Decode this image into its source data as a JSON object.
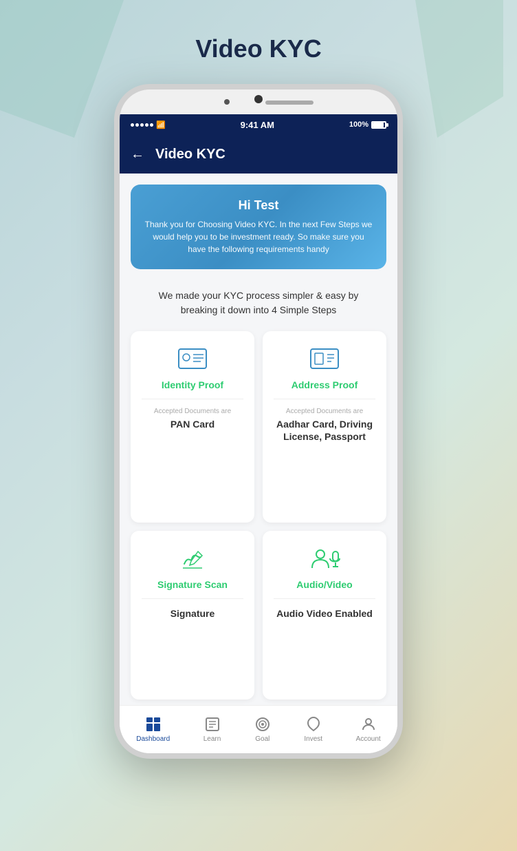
{
  "page": {
    "title": "Video KYC"
  },
  "header": {
    "title": "Video KYC",
    "back_label": "←"
  },
  "status_bar": {
    "time": "9:41 AM",
    "battery": "100%"
  },
  "banner": {
    "greeting": "Hi Test",
    "description": "Thank you for Choosing Video KYC. In the next Few Steps we would help you to be investment ready. So make sure you have the following requirements handy"
  },
  "steps_description": "We made your KYC process simpler & easy by breaking it down into 4 Simple Steps",
  "cards": [
    {
      "id": "identity-proof",
      "title": "Identity Proof",
      "accepted_label": "Accepted Documents are",
      "document": "PAN Card"
    },
    {
      "id": "address-proof",
      "title": "Address Proof",
      "accepted_label": "Accepted Documents are",
      "document": "Aadhar Card, Driving License, Passport"
    },
    {
      "id": "signature-scan",
      "title": "Signature Scan",
      "accepted_label": "",
      "document": "Signature"
    },
    {
      "id": "audio-video",
      "title": "Audio/Video",
      "accepted_label": "",
      "document": "Audio Video Enabled"
    }
  ],
  "bottom_nav": [
    {
      "id": "dashboard",
      "label": "Dashboard",
      "active": true
    },
    {
      "id": "learn",
      "label": "Learn",
      "active": false
    },
    {
      "id": "goal",
      "label": "Goal",
      "active": false
    },
    {
      "id": "invest",
      "label": "Invest",
      "active": false
    },
    {
      "id": "account",
      "label": "Account",
      "active": false
    }
  ]
}
